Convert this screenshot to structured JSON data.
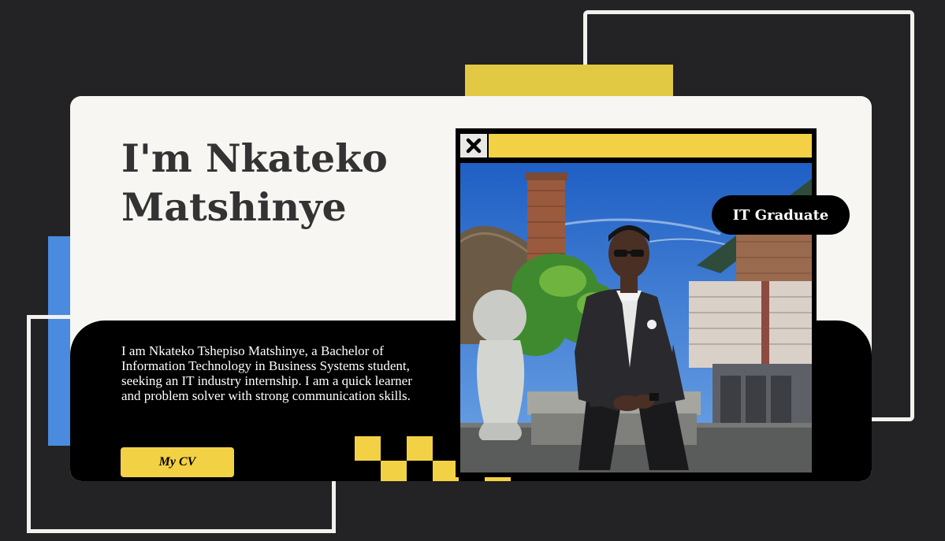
{
  "hero": {
    "title": "I'm Nkateko Matshinye",
    "bio": "I am Nkateko Tshepiso Matshinye, a Bachelor of Information Technology in Business Systems student, seeking an IT industry internship. I am a quick learner and problem solver with strong communication skills.",
    "cv_button_label": "My CV"
  },
  "photo_window": {
    "close_icon": "close-icon",
    "photo_description": "portrait-photo",
    "badge_label": "IT Graduate"
  },
  "colors": {
    "background": "#232224",
    "card": "#f7f6f2",
    "accent_yellow": "#f3d145",
    "accent_blue": "#4a8be0",
    "black": "#000000"
  }
}
